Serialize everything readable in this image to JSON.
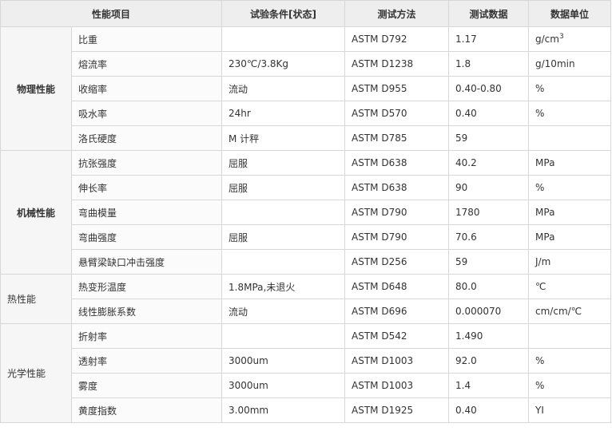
{
  "header": {
    "col_item": "性能项目",
    "col_condition": "试验条件[状态]",
    "col_method": "测试方法",
    "col_data": "测试数据",
    "col_unit": "数据单位"
  },
  "groups": [
    {
      "category": "物理性能",
      "rows": [
        {
          "item": "比重",
          "condition": "",
          "method": "ASTM D792",
          "value": "1.17",
          "unit": "g/cm",
          "unit_sup": "3"
        },
        {
          "item": "熔流率",
          "condition": "230℃/3.8Kg",
          "method": "ASTM D1238",
          "value": "1.8",
          "unit": "g/10min"
        },
        {
          "item": "收缩率",
          "condition": "流动",
          "method": "ASTM D955",
          "value": "0.40-0.80",
          "unit": "%"
        },
        {
          "item": "吸水率",
          "condition": "24hr",
          "method": "ASTM D570",
          "value": "0.40",
          "unit": "%"
        },
        {
          "item": "洛氏硬度",
          "condition": "M 计秤",
          "method": "ASTM D785",
          "value": "59",
          "unit": ""
        }
      ]
    },
    {
      "category": "机械性能",
      "rows": [
        {
          "item": "抗张强度",
          "condition": "屈服",
          "method": "ASTM D638",
          "value": "40.2",
          "unit": "MPa"
        },
        {
          "item": "伸长率",
          "condition": "屈服",
          "method": "ASTM D638",
          "value": "90",
          "unit": "%"
        },
        {
          "item": "弯曲模量",
          "condition": "",
          "method": "ASTM D790",
          "value": "1780",
          "unit": "MPa"
        },
        {
          "item": "弯曲强度",
          "condition": "屈服",
          "method": "ASTM D790",
          "value": "70.6",
          "unit": "MPa"
        },
        {
          "item": "悬臂梁缺口冲击强度",
          "condition": "",
          "method": "ASTM D256",
          "value": "59",
          "unit": "J/m"
        }
      ]
    },
    {
      "category": "热性能",
      "rows": [
        {
          "item": "热变形温度",
          "condition": "1.8MPa,未退火",
          "method": "ASTM D648",
          "value": "80.0",
          "unit": "℃"
        },
        {
          "item": "线性膨胀系数",
          "condition": "流动",
          "method": "ASTM D696",
          "value": "0.000070",
          "unit": "cm/cm/℃"
        }
      ]
    },
    {
      "category": "光学性能",
      "rows": [
        {
          "item": "折射率",
          "condition": "",
          "method": "ASTM D542",
          "value": "1.490",
          "unit": ""
        },
        {
          "item": "透射率",
          "condition": "3000um",
          "method": "ASTM D1003",
          "value": "92.0",
          "unit": "%"
        },
        {
          "item": "雾度",
          "condition": "3000um",
          "method": "ASTM D1003",
          "value": "1.4",
          "unit": "%"
        },
        {
          "item": "黄度指数",
          "condition": "3.00mm",
          "method": "ASTM D1925",
          "value": "0.40",
          "unit": "YI"
        }
      ]
    }
  ]
}
